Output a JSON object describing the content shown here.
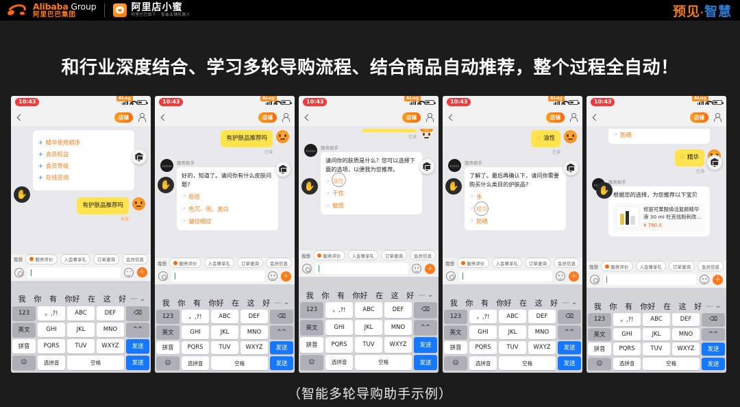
{
  "topbar": {
    "alibaba_en": "Alibaba",
    "alibaba_group": " Group",
    "alibaba_cn": "阿里巴巴集团",
    "dianxiaomi_title": "阿里店小蜜",
    "dianxiaomi_sub": "阿里巴巴旗下 · 智能店铺机器人",
    "right_brand_1": "预见",
    "right_brand_mid": "·",
    "right_brand_2": "智慧",
    "accent_orange": "#f07c1a",
    "accent_blue": "#2f7fd4"
  },
  "headline": "和行业深度结合、学习多轮导购流程、结合商品自动推荐，整个过程全自动！",
  "caption": "（智能多轮导购助手示例）",
  "phone_common": {
    "clock": "10:43",
    "alog_badge": "ALog",
    "shop_pill": "店铺",
    "sender_name": "服务助手",
    "read_label": "已读",
    "chips": [
      {
        "type": "plain",
        "label": "我想"
      },
      {
        "type": "dot",
        "label": "服务评价"
      },
      {
        "type": "chip",
        "label": "入会尊享礼"
      },
      {
        "type": "chip",
        "label": "订单查询"
      },
      {
        "type": "chip",
        "label": "会员信息"
      }
    ],
    "input_placeholder": "",
    "input_value": "",
    "keyboard": {
      "candidates": [
        "我",
        "你",
        "有",
        "你好",
        "在",
        "这",
        "好"
      ],
      "sep": "一",
      "chevron": "⌄",
      "rows": [
        [
          {
            "label": "123",
            "style": "fn"
          },
          {
            "label": "。,?!",
            "style": "key"
          },
          {
            "label": "ABC",
            "style": "key"
          },
          {
            "label": "DEF",
            "style": "key"
          },
          {
            "label": "⌫",
            "style": "fn"
          }
        ],
        [
          {
            "label": "英文",
            "style": "fn"
          },
          {
            "label": "GHI",
            "style": "key"
          },
          {
            "label": "JKL",
            "style": "key"
          },
          {
            "label": "MNO",
            "style": "key"
          },
          {
            "label": "^^",
            "style": "fn"
          }
        ],
        [
          {
            "label": "拼音",
            "style": "fn light"
          },
          {
            "label": "PQRS",
            "style": "key"
          },
          {
            "label": "TUV",
            "style": "key"
          },
          {
            "label": "WXYZ",
            "style": "key"
          },
          {
            "label": "发送",
            "style": "send"
          }
        ],
        [
          {
            "label": "☺",
            "style": "fn"
          },
          {
            "label": "选拼音",
            "style": "key sm"
          },
          {
            "label": "空格",
            "style": "key sm wide"
          }
        ]
      ]
    }
  },
  "phones": [
    {
      "id": "phone-1",
      "menu_card": {
        "items": [
          "精华使用顺序",
          "会员权益",
          "会员等级",
          "在线咨询"
        ],
        "bullet": "✈"
      },
      "user_bubble": "有护肤品推荐吗",
      "user_read": "未读"
    },
    {
      "id": "phone-2",
      "user_bubble_top": "有护肤品推荐吗",
      "user_read": "已读",
      "bot_text": "好的，知道了。请问你有什么皮肤问题?",
      "bot_options": [
        "痘痘",
        "色沉、斑、美白",
        "皱纹细纹"
      ],
      "bullet": "☞"
    },
    {
      "id": "phone-3",
      "user_read": "已读",
      "bot_text": "请问你的肤质是什么？您可以选择下面的选项，以便我为您推荐。",
      "bot_options": [
        "油性",
        "干性",
        "敏感"
      ],
      "bullet": "☞"
    },
    {
      "id": "phone-4",
      "user_bubble_top": "油性",
      "user_read": "已读",
      "bot_text": "了解了。最后再确认下，请问你需要购买什么类目的护肤品?",
      "bot_options": [
        "水",
        "精华",
        "防晒"
      ],
      "bullet": "☞"
    },
    {
      "id": "phone-5",
      "prev_option": "防晒",
      "user_bubble_top": "精华",
      "user_read": "已读",
      "bot_text": "根据您的选择，为您推荐以下宝贝",
      "product": {
        "title": "修丽可果酸焕活复颜精华液 30 ml 杜克祛粉刺改...",
        "price": "¥ 780.0"
      },
      "bullet": "☞"
    }
  ]
}
